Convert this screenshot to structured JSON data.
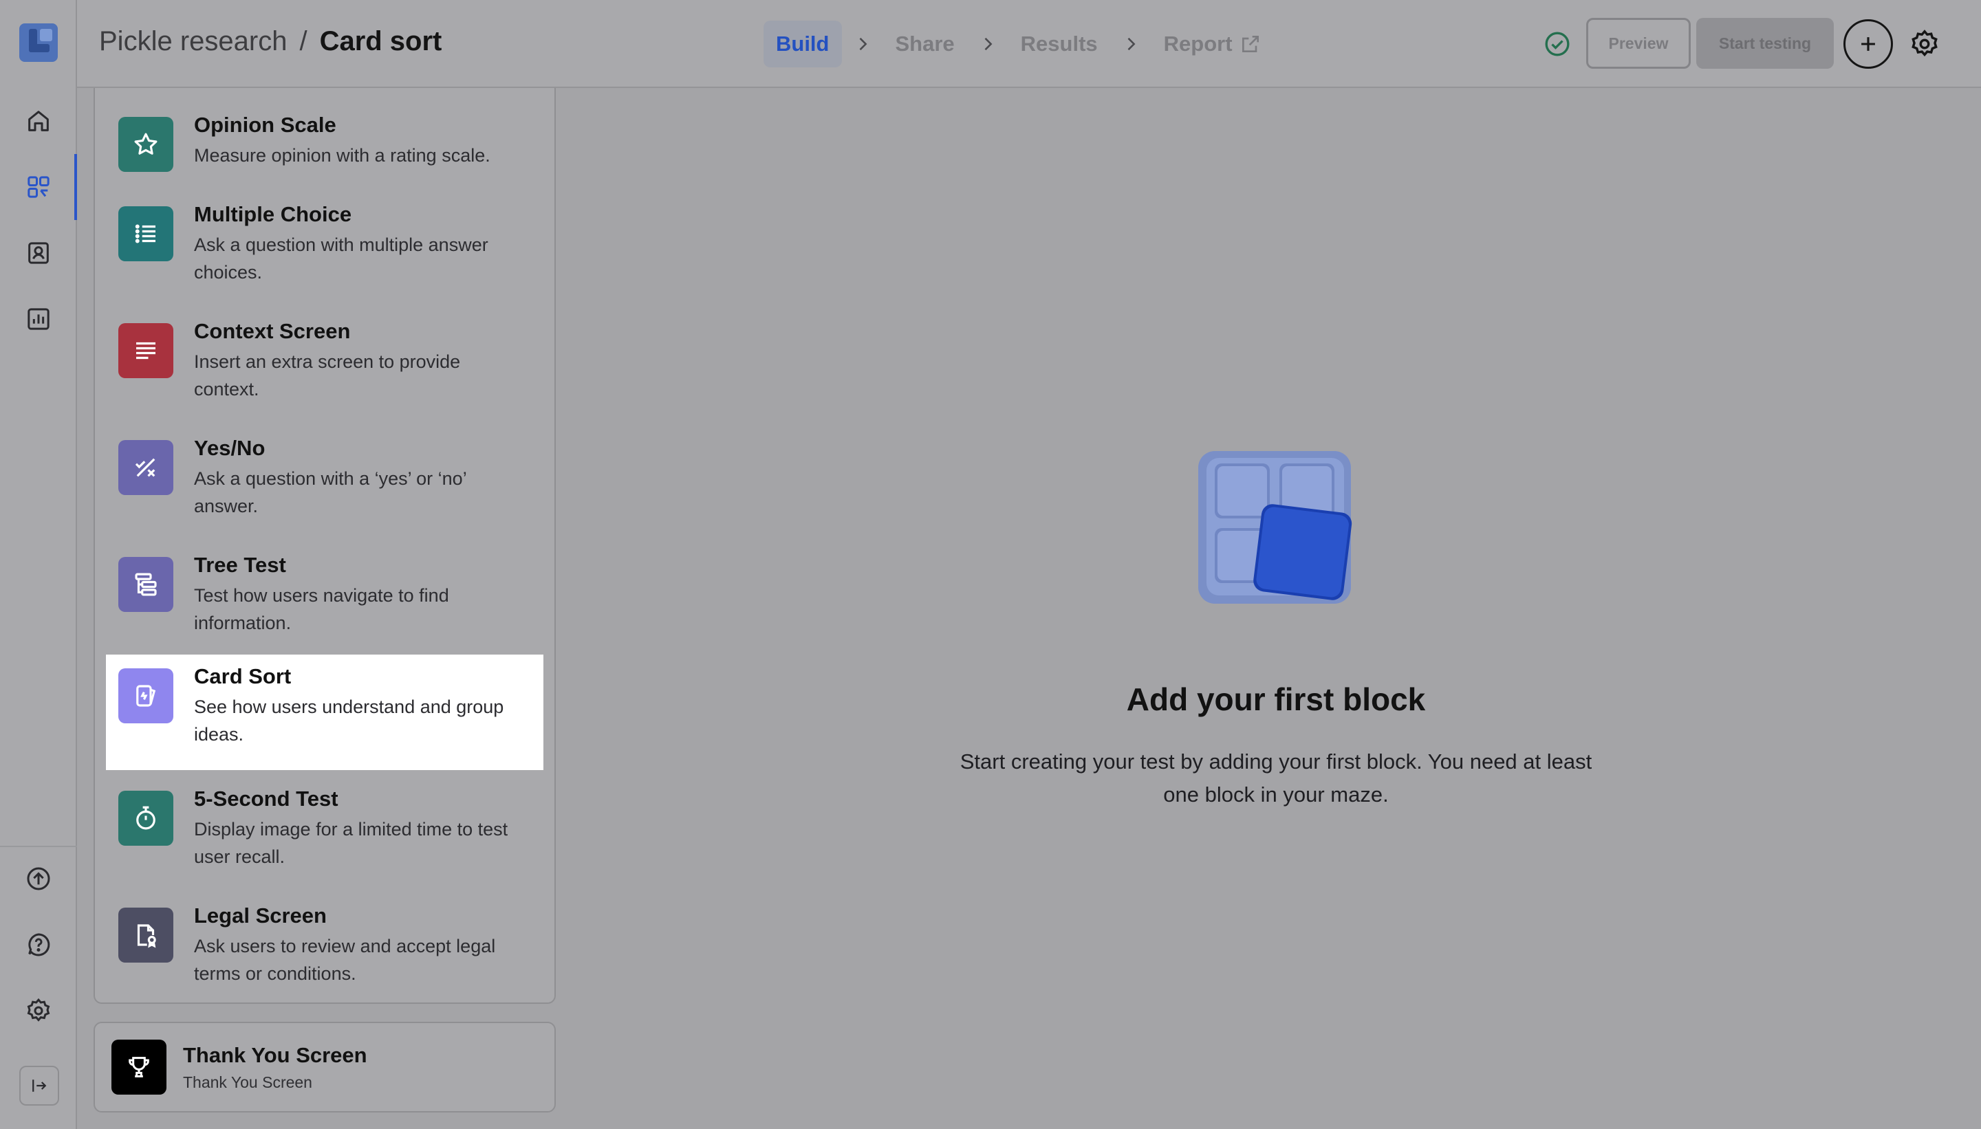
{
  "header": {
    "project": "Pickle research",
    "separator": "/",
    "title": "Card sort",
    "steps": [
      {
        "label": "Build",
        "active": true
      },
      {
        "label": "Share",
        "active": false
      },
      {
        "label": "Results",
        "active": false
      },
      {
        "label": "Report",
        "active": false
      }
    ],
    "preview_label": "Preview",
    "start_label": "Start testing"
  },
  "rail": {
    "items": [
      "home-icon",
      "blocks-icon",
      "contacts-icon",
      "analytics-icon"
    ],
    "bottom": [
      "upload-icon",
      "help-icon",
      "settings-icon",
      "collapse-icon"
    ]
  },
  "blocks": [
    {
      "title": "Opinion Scale",
      "desc": "Measure opinion with a rating scale.",
      "color": "#2b776d",
      "icon": "star-icon"
    },
    {
      "title": "Multiple Choice",
      "desc": "Ask a question with multiple answer choices.",
      "color": "#237577",
      "icon": "list-icon"
    },
    {
      "title": "Context Screen",
      "desc": "Insert an extra screen to provide context.",
      "color": "#a8323e",
      "icon": "text-lines-icon"
    },
    {
      "title": "Yes/No",
      "desc": "Ask a question with a ‘yes’ or ‘no’ answer.",
      "color": "#6a66ac",
      "icon": "check-cross-icon"
    },
    {
      "title": "Tree Test",
      "desc": "Test how users navigate to find information.",
      "color": "#6a66ac",
      "icon": "tree-icon"
    },
    {
      "title": "Card Sort",
      "desc": "See how users understand and group ideas.",
      "color": "#8f86ee",
      "icon": "card-sort-icon",
      "selected": true
    },
    {
      "title": "5-Second Test",
      "desc": "Display image for a limited time to test user recall.",
      "color": "#2b776d",
      "icon": "stopwatch-icon"
    },
    {
      "title": "Legal Screen",
      "desc": "Ask users to review and accept legal terms or conditions.",
      "color": "#4d4e63",
      "icon": "legal-doc-icon"
    }
  ],
  "thanks": {
    "title": "Thank You Screen",
    "subtitle": "Thank You Screen"
  },
  "empty": {
    "title": "Add your first block",
    "desc": "Start creating your test by adding your first block. You need at least one block in your maze."
  }
}
